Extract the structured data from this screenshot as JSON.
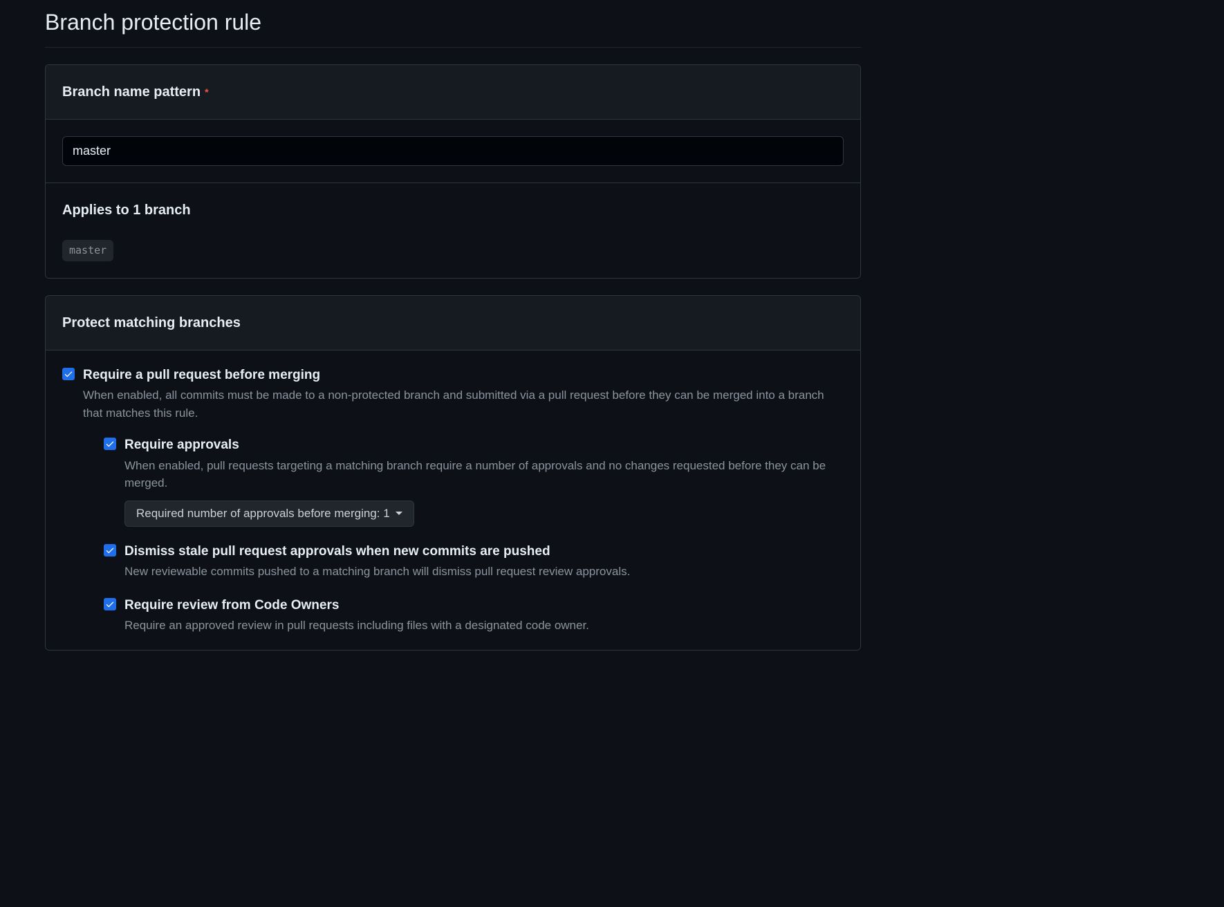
{
  "page": {
    "title": "Branch protection rule"
  },
  "branchPattern": {
    "headerTitle": "Branch name pattern",
    "requiredMark": "*",
    "value": "master",
    "appliesTitle": "Applies to 1 branch",
    "badge": "master"
  },
  "protect": {
    "headerTitle": "Protect matching branches",
    "options": [
      {
        "title": "Require a pull request before merging",
        "description": "When enabled, all commits must be made to a non-protected branch and submitted via a pull request before they can be merged into a branch that matches this rule."
      }
    ],
    "subOptions": [
      {
        "title": "Require approvals",
        "description": "When enabled, pull requests targeting a matching branch require a number of approvals and no changes requested before they can be merged.",
        "dropdownLabel": "Required number of approvals before merging: 1"
      },
      {
        "title": "Dismiss stale pull request approvals when new commits are pushed",
        "description": "New reviewable commits pushed to a matching branch will dismiss pull request review approvals."
      },
      {
        "title": "Require review from Code Owners",
        "description": "Require an approved review in pull requests including files with a designated code owner."
      }
    ]
  }
}
